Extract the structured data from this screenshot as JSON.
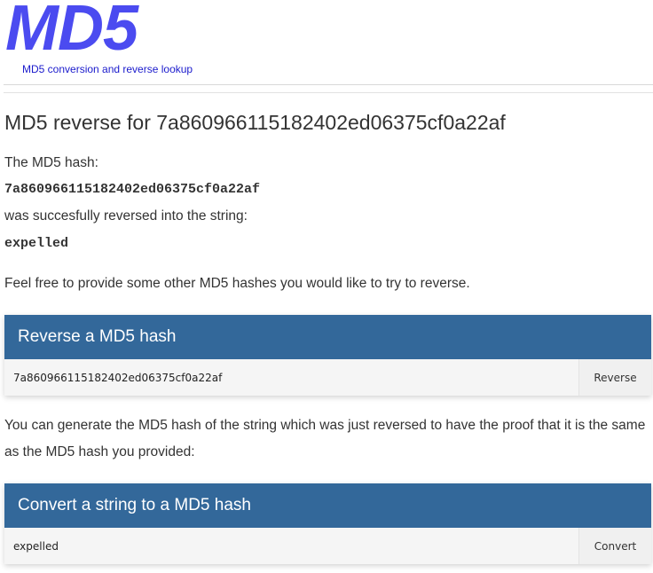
{
  "header": {
    "logo_text": "MD5",
    "tagline": "MD5 conversion and reverse lookup"
  },
  "main": {
    "title": "MD5 reverse for 7a860966115182402ed06375cf0a22af",
    "hash_label": "The MD5 hash:",
    "hash_value": "7a860966115182402ed06375cf0a22af",
    "reversed_label": "was succesfully reversed into the string:",
    "reversed_value": "expelled",
    "invite_text": "Feel free to provide some other MD5 hashes you would like to try to reverse.",
    "proof_text": "You can generate the MD5 hash of the string which was just reversed to have the proof that it is the same as the MD5 hash you provided:"
  },
  "reverse_panel": {
    "heading": "Reverse a MD5 hash",
    "input_value": "7a860966115182402ed06375cf0a22af",
    "button_label": "Reverse"
  },
  "convert_panel": {
    "heading": "Convert a string to a MD5 hash",
    "input_value": "expelled",
    "button_label": "Convert"
  },
  "colors": {
    "logo": "#4b4bf0",
    "tagline": "#1a1acc",
    "panel_heading_bg": "#33689a",
    "panel_row_bg": "#f5f5f5"
  }
}
